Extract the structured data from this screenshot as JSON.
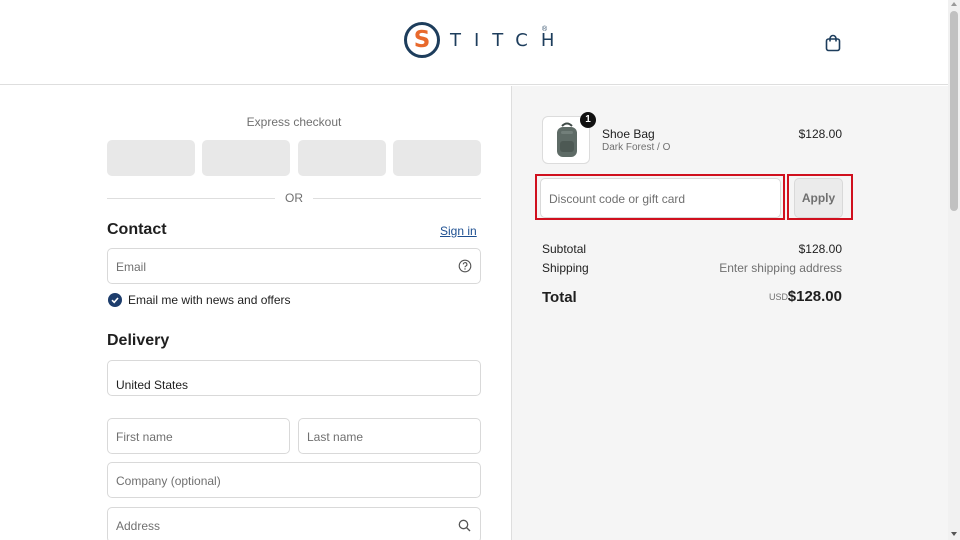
{
  "header": {
    "logo_letter": "S",
    "logo_text": "TITCH",
    "logo_mark": "®",
    "cart_icon": "shopping-bag-icon"
  },
  "express": {
    "title": "Express checkout",
    "or_label": "OR"
  },
  "contact": {
    "title": "Contact",
    "sign_in_label": "Sign in",
    "email_placeholder": "Email",
    "newsletter_label": "Email me with news and offers",
    "newsletter_checked": true
  },
  "delivery": {
    "title": "Delivery",
    "country_value": "United States",
    "first_name_placeholder": "First name",
    "last_name_placeholder": "Last name",
    "company_placeholder": "Company (optional)",
    "address_placeholder": "Address"
  },
  "order": {
    "item": {
      "name": "Shoe Bag",
      "variant": "Dark Forest / O",
      "price": "$128.00",
      "quantity": "1"
    },
    "discount_placeholder": "Discount code or gift card",
    "apply_label": "Apply",
    "subtotal_label": "Subtotal",
    "subtotal_value": "$128.00",
    "shipping_label": "Shipping",
    "shipping_value": "Enter shipping address",
    "total_label": "Total",
    "total_currency": "USD",
    "total_value": "$128.00"
  },
  "colors": {
    "brand_navy": "#1d3d5c",
    "brand_orange": "#e8692c",
    "highlight_red": "#d0101e",
    "link_blue": "#1d4f91"
  }
}
